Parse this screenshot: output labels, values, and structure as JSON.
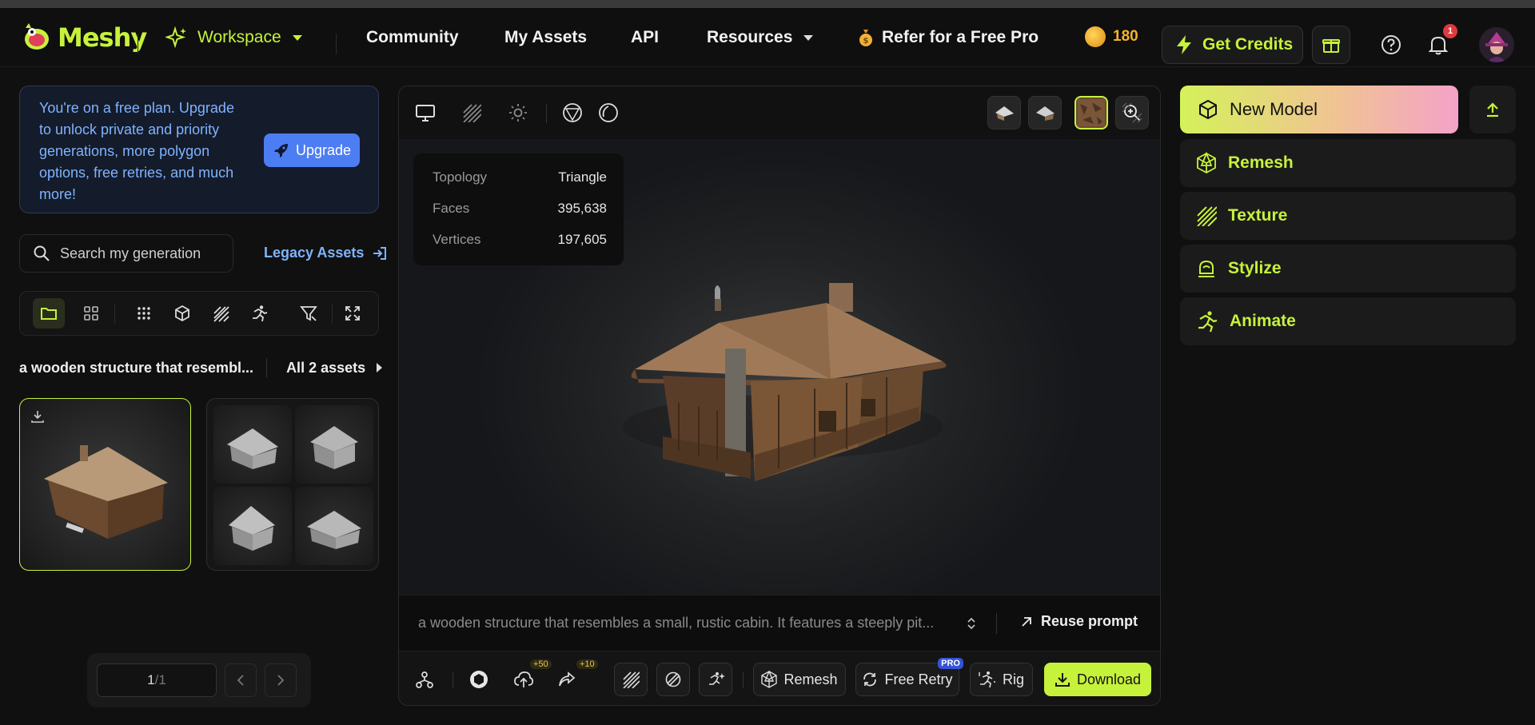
{
  "header": {
    "logo_text": "Meshy",
    "nav": {
      "workspace": "Workspace",
      "community": "Community",
      "my_assets": "My Assets",
      "api": "API",
      "resources": "Resources",
      "refer": "Refer for a Free Pro"
    },
    "credits": "180",
    "get_credits": "Get Credits",
    "notification_count": "1"
  },
  "promo": {
    "text": "You're on a free plan. Upgrade to unlock private and priority generations, more polygon options, free retries, and much more!",
    "upgrade_label": "Upgrade"
  },
  "search": {
    "placeholder": "Search my generation",
    "legacy_assets": "Legacy Assets"
  },
  "generation": {
    "title": "a wooden structure that resembl...",
    "all_assets": "All 2 assets"
  },
  "pager": {
    "current": "1",
    "total": "/1"
  },
  "viewer": {
    "info": [
      {
        "key": "Topology",
        "value": "Triangle"
      },
      {
        "key": "Faces",
        "value": "395,638"
      },
      {
        "key": "Vertices",
        "value": "197,605"
      }
    ],
    "prompt": "a wooden structure that resembles a small, rustic cabin. It features a steeply pit...",
    "reuse_prompt": "Reuse prompt",
    "toolbar": {
      "upload_bonus": "+50",
      "share_bonus": "+10",
      "remesh": "Remesh",
      "free_retry": "Free Retry",
      "pro_badge": "PRO",
      "rig": "Rig",
      "download": "Download"
    }
  },
  "right_panel": {
    "new_model": "New Model",
    "tools": [
      "Remesh",
      "Texture",
      "Stylize",
      "Animate"
    ]
  },
  "colors": {
    "accent": "#c6f23c",
    "link_blue": "#7fb3ff",
    "upgrade_blue": "#4d7df2",
    "coin": "#f5b32c",
    "badge_red": "#e0393d"
  }
}
